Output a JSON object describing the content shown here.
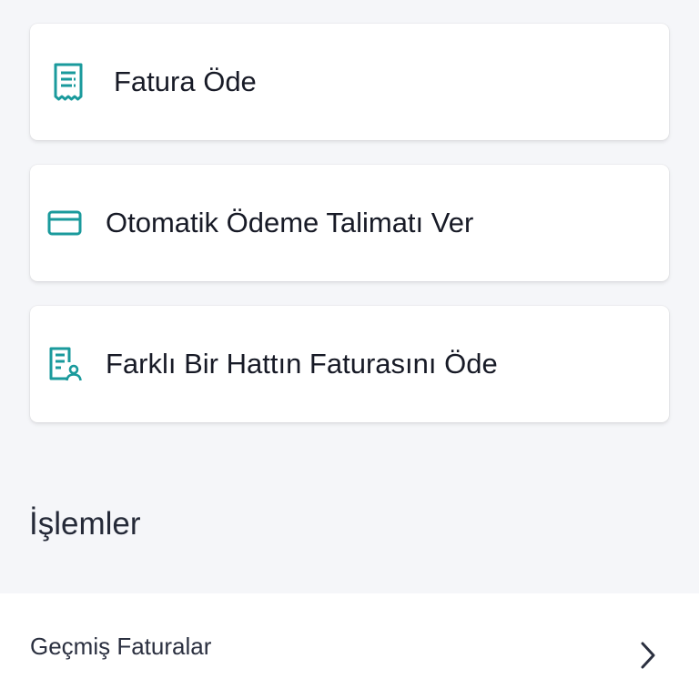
{
  "colors": {
    "accent": "#1a9a9c",
    "background": "#f5f6f9",
    "card": "#ffffff"
  },
  "actions": [
    {
      "label": "Fatura Öde",
      "icon": "receipt-icon"
    },
    {
      "label": "Otomatik Ödeme Talimatı Ver",
      "icon": "credit-card-icon"
    },
    {
      "label": "Farklı Bir Hattın Faturasını Öde",
      "icon": "bill-person-icon"
    }
  ],
  "section": {
    "title": "İşlemler"
  },
  "list": {
    "items": [
      {
        "label": "Geçmiş Faturalar",
        "icon": "chevron-right-icon"
      }
    ]
  }
}
